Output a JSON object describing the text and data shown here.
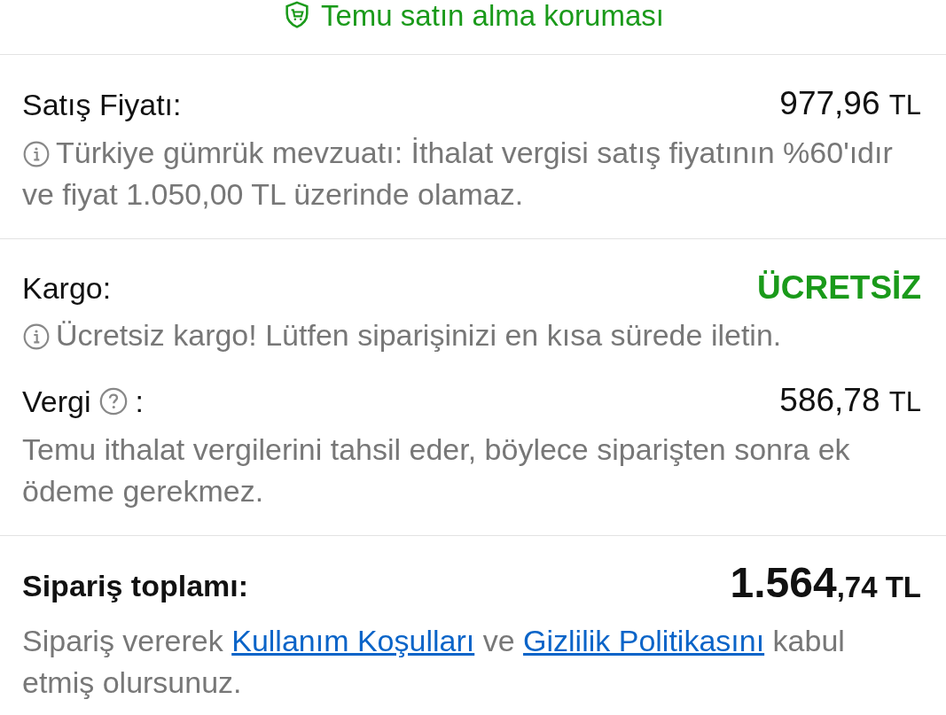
{
  "protection": {
    "label": "Temu satın alma koruması"
  },
  "sections": [
    [
      {
        "kind": "amount",
        "label": "Satış Fiyatı:",
        "help": false,
        "amount": "977,96",
        "currency": "TL",
        "note": {
          "info_icon": true,
          "text": "Türkiye gümrük mevzuatı: İthalat vergisi satış fiyatının %60'ıdır ve fiyat 1.050,00 TL üzerinde olamaz."
        }
      }
    ],
    [
      {
        "kind": "free",
        "label": "Kargo:",
        "help": false,
        "value": "ÜCRETSİZ",
        "note": {
          "info_icon": true,
          "text": "Ücretsiz kargo! Lütfen siparişinizi en kısa sürede iletin."
        }
      },
      {
        "kind": "amount",
        "label": "Vergi",
        "help": true,
        "colon": ":",
        "amount": "586,78",
        "currency": "TL",
        "note": {
          "info_icon": false,
          "text": "Temu ithalat vergilerini tahsil eder, böylece siparişten sonra ek ödeme gerekmez."
        }
      }
    ]
  ],
  "total": {
    "label": "Sipariş toplamı:",
    "amount": "1.564",
    "cents": ",74",
    "currency": "TL"
  },
  "terms": [
    {
      "kind": "text",
      "text": "Sipariş vererek"
    },
    {
      "kind": "link",
      "text": "Kullanım Koşulları"
    },
    {
      "kind": "text",
      "text": "ve"
    },
    {
      "kind": "link",
      "text": "Gizlilik Politikasını"
    },
    {
      "kind": "text",
      "text": "kabul etmiş olursunuz."
    }
  ]
}
